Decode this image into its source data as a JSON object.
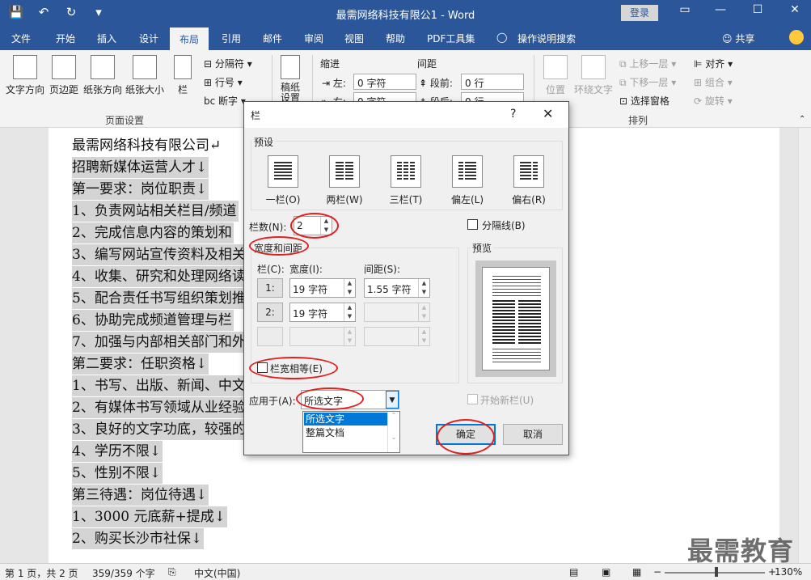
{
  "app": {
    "title": "最需网络科技有限公1 - Word",
    "login": "登录"
  },
  "qat": {
    "save_icon": "save-icon",
    "undo_icon": "undo-icon",
    "redo_icon": "redo-icon",
    "customize_icon": "customize-icon"
  },
  "tabs": [
    "文件",
    "开始",
    "插入",
    "设计",
    "布局",
    "引用",
    "邮件",
    "审阅",
    "视图",
    "帮助",
    "PDF工具集",
    "操作说明搜索"
  ],
  "active_tab": "布局",
  "share": "共享",
  "ribbon": {
    "text_direction": "文字方向",
    "margins": "页边距",
    "orientation": "纸张方向",
    "size": "纸张大小",
    "columns": "栏",
    "breaks": "分隔符",
    "line_numbers": "行号",
    "hyphenation": "断字",
    "page_setup_label": "页面设置",
    "draft_settings": "稿纸\n设置",
    "indent_label": "缩进",
    "spacing_label": "间距",
    "indent_left_label": "左:",
    "indent_left_value": "0 字符",
    "indent_right_label": "右:",
    "indent_right_value": "0 字符",
    "spacing_before_label": "段前:",
    "spacing_before_value": "0 行",
    "spacing_after_label": "段后:",
    "spacing_after_value": "0 行",
    "position": "位置",
    "wrap_text": "环绕文字",
    "bring_forward": "上移一层",
    "send_backward": "下移一层",
    "selection_pane": "选择窗格",
    "align": "对齐",
    "group": "组合",
    "rotate": "旋转",
    "arrange_label": "排列"
  },
  "document": {
    "lines": [
      "最需网络科技有限公司↵",
      "招聘新媒体运营人才↓",
      "第一要求：岗位职责↓",
      "1、负责网站相关栏目/频道",
      "2、完成信息内容的策划和",
      "3、编写网站宣传资料及相关",
      "4、收集、研究和处理网络读",
      "5、配合责任书写组织策划推",
      "6、协助完成频道管理与栏",
      "7、加强与内部相关部门和外",
      "第二要求：任职资格↓",
      "1、书写、出版、新闻、中文",
      "2、有媒体书写领域从业经验",
      "3、良好的文字功底，较强的",
      "4、学历不限↓",
      "5、性别不限↓",
      "第三待遇：岗位待遇↓",
      "1、3000 元底薪+提成↓",
      "2、购买长沙市社保↓"
    ]
  },
  "status": {
    "page": "第 1 页，共 2 页",
    "words": "359/359 个字",
    "language": "中文(中国)",
    "zoom": "130%",
    "zoom_minus": "−",
    "zoom_plus": "+"
  },
  "watermark": "最需教育",
  "dialog": {
    "title": "栏",
    "help": "?",
    "close": "✕",
    "presets_label": "预设",
    "presets": [
      "一栏(O)",
      "两栏(W)",
      "三栏(T)",
      "偏左(L)",
      "偏右(R)"
    ],
    "num_columns_label": "栏数(N):",
    "num_columns_value": "2",
    "line_between_label": "分隔线(B)",
    "width_spacing_label": "宽度和间距",
    "preview_label": "预览",
    "col_header": "栏(C):",
    "width_header": "宽度(I):",
    "spacing_header": "间距(S):",
    "rows": [
      {
        "num": "1:",
        "width": "19 字符",
        "spacing": "1.55 字符"
      },
      {
        "num": "2:",
        "width": "19 字符",
        "spacing": ""
      },
      {
        "num": "",
        "width": "",
        "spacing": ""
      }
    ],
    "equal_width_label": "栏宽相等(E)",
    "equal_width_checked": false,
    "apply_to_label": "应用于(A):",
    "apply_to_value": "所选文字",
    "apply_to_options": [
      "所选文字",
      "整篇文档"
    ],
    "start_new_column_label": "开始新栏(U)",
    "ok": "确定",
    "cancel": "取消"
  },
  "colors": {
    "title_blue": "#2b579a",
    "highlight_gray": "#d4d4d4",
    "annotation_red": "#e02020",
    "selected_blue": "#0078d7"
  }
}
